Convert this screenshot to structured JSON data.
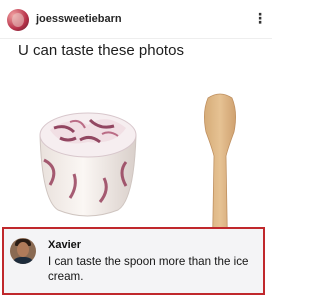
{
  "post": {
    "username": "joessweetiebarn",
    "caption": "U can taste these photos",
    "more_icon": "more-vertical-icon",
    "media": [
      {
        "name": "ice-cream-cup-photo"
      },
      {
        "name": "wooden-spoon-photo"
      }
    ]
  },
  "comment": {
    "author": "Xavier",
    "text": "I can taste the spoon more than the ice cream.",
    "highlight_color": "#c0282c"
  }
}
